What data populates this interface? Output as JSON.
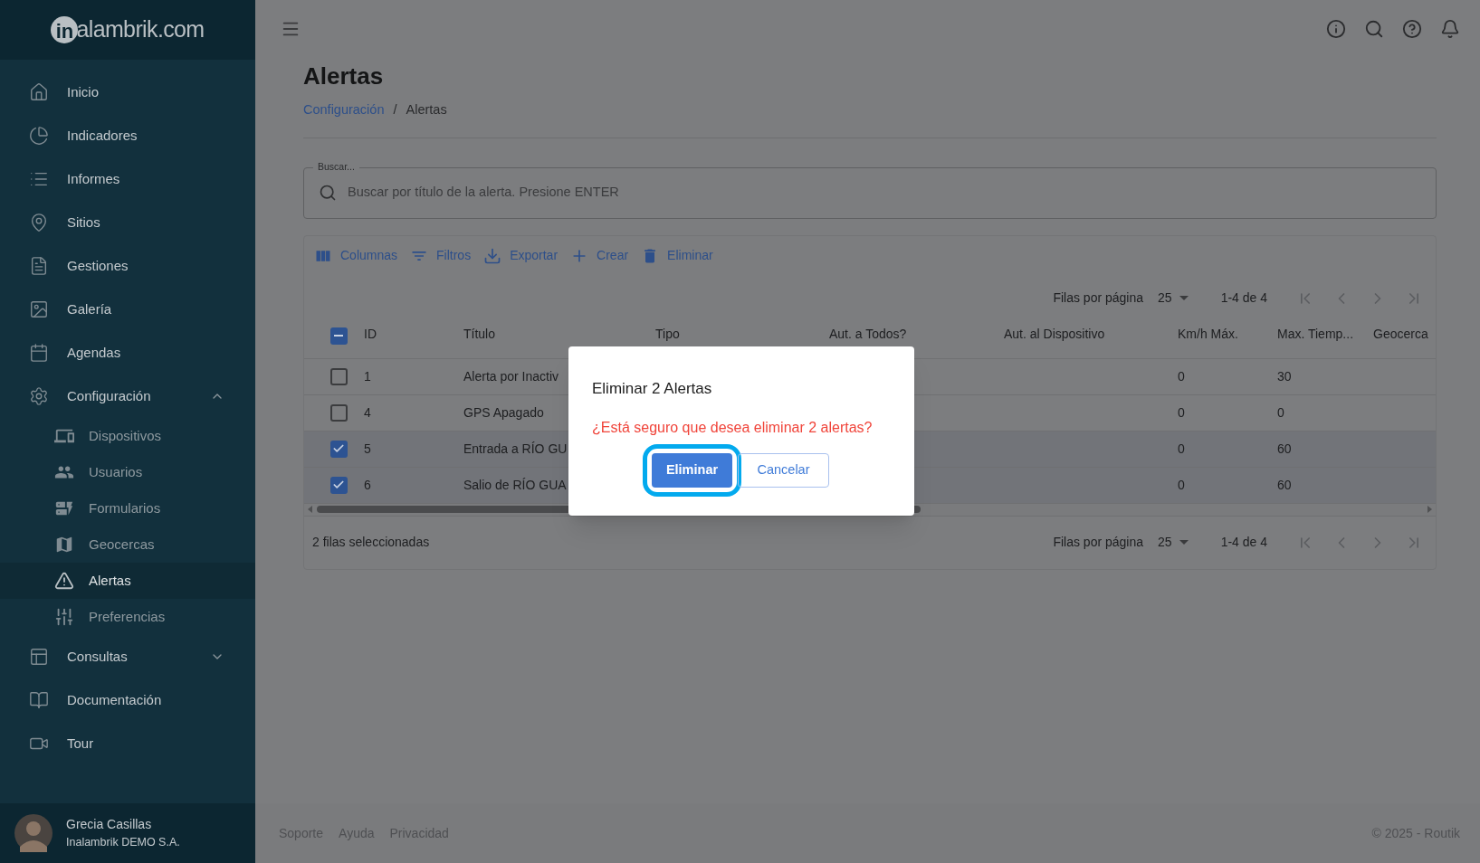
{
  "logo": {
    "mark": "in",
    "text": "alambrik.com"
  },
  "sidebar": {
    "items": [
      {
        "label": "Inicio",
        "selected": false
      },
      {
        "label": "Indicadores",
        "selected": false
      },
      {
        "label": "Informes",
        "selected": false
      },
      {
        "label": "Sitios",
        "selected": false
      },
      {
        "label": "Gestiones",
        "selected": false
      },
      {
        "label": "Galería",
        "selected": false
      },
      {
        "label": "Agendas",
        "selected": false
      },
      {
        "label": "Configuración",
        "selected": false,
        "expanded": true,
        "children": [
          {
            "label": "Dispositivos",
            "selected": false
          },
          {
            "label": "Usuarios",
            "selected": false
          },
          {
            "label": "Formularios",
            "selected": false
          },
          {
            "label": "Geocercas",
            "selected": false
          },
          {
            "label": "Alertas",
            "selected": true
          },
          {
            "label": "Preferencias",
            "selected": false
          }
        ]
      },
      {
        "label": "Consultas",
        "selected": false,
        "expanded": false
      },
      {
        "label": "Documentación",
        "selected": false
      },
      {
        "label": "Tour",
        "selected": false
      }
    ],
    "user": {
      "name": "Grecia Casillas",
      "company": "Inalambrik DEMO S.A."
    }
  },
  "page": {
    "title": "Alertas",
    "breadcrumb": [
      {
        "label": "Configuración",
        "kind": "link"
      },
      {
        "label": "/",
        "kind": "separator"
      },
      {
        "label": "Alertas",
        "kind": "current"
      }
    ]
  },
  "search": {
    "label": "Buscar...",
    "placeholder": "Buscar por título de la alerta. Presione ENTER"
  },
  "toolbar": [
    {
      "label": "Columnas"
    },
    {
      "label": "Filtros"
    },
    {
      "label": "Exportar"
    },
    {
      "label": "Crear"
    },
    {
      "label": "Eliminar"
    }
  ],
  "pagination_top": {
    "rows_label": "Filas por página",
    "rows_value": "25",
    "range": "1-4 de 4"
  },
  "table": {
    "header_checkbox": {
      "indeterminate": true
    },
    "columns": [
      "ID",
      "Título",
      "Tipo",
      "Aut. a Todos?",
      "Aut. al Dispositivo",
      "Km/h Máx.",
      "Max. Tiemp...",
      "Geocerca"
    ],
    "rows": [
      {
        "checked": false,
        "id": "1",
        "title": "Alerta por Inactiv",
        "kmh": "0",
        "max_time": "30"
      },
      {
        "checked": false,
        "id": "4",
        "title": "GPS Apagado",
        "kmh": "0",
        "max_time": "0"
      },
      {
        "checked": true,
        "id": "5",
        "title": "Entrada a RÍO GU",
        "kmh": "0",
        "max_time": "60"
      },
      {
        "checked": true,
        "id": "6",
        "title": "Salio de RÍO GUA",
        "kmh": "0",
        "max_time": "60"
      }
    ]
  },
  "selection_count": "2 filas seleccionadas",
  "pagination_bottom": {
    "rows_label": "Filas por página",
    "rows_value": "25",
    "range": "1-4 de 4"
  },
  "footer": {
    "links": [
      "Soporte",
      "Ayuda",
      "Privacidad"
    ],
    "copyright": "© 2025 - Routik"
  },
  "dialog": {
    "title": "Eliminar 2 Alertas",
    "message": "¿Está seguro que desea eliminar 2 alertas?",
    "confirm": {
      "label": "Eliminar",
      "focused": true
    },
    "cancel": {
      "label": "Cancelar"
    }
  }
}
